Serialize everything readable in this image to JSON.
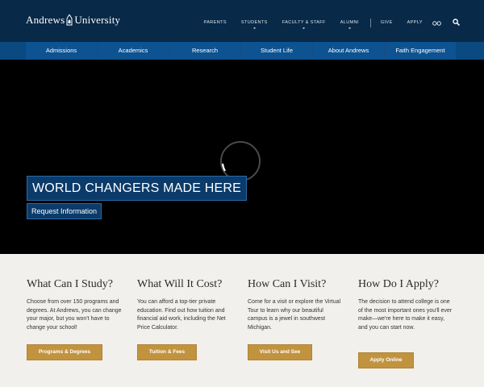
{
  "header": {
    "logo_left": "Andrews",
    "logo_right": "University",
    "links": [
      "Parents",
      "Students",
      "Faculty & Staff",
      "Alumni"
    ],
    "utility_links": [
      "Give",
      "Apply"
    ],
    "icons": [
      "glasses-icon",
      "search-icon"
    ]
  },
  "subnav": [
    "Admissions",
    "Academics",
    "Research",
    "Student Life",
    "About Andrews",
    "Faith Engagement"
  ],
  "hero": {
    "headline": "WORLD CHANGERS MADE HERE",
    "cta": "Request Information"
  },
  "columns": [
    {
      "title": "What Can I Study?",
      "text": "Choose from over 150 programs and degrees. At Andrews, you can change your major, but you won't have to change your school!",
      "button": "Programs & Degrees"
    },
    {
      "title": "What Will It Cost?",
      "text": "You can afford a top-tier private education. Find out how tuition and financial aid work, including the Net Price Calculator.",
      "button": "Tuition & Fees"
    },
    {
      "title": "How Can I Visit?",
      "text": "Come for a visit or explore the Virtual Tour to learn why our beautiful campus is a jewel in southwest Michigan.",
      "button": "Visit Us and See"
    },
    {
      "title": "How Do I Apply?",
      "text": "The decision to attend college is one of the most important ones you'll ever make—we're here to make it easy, and you can start now.",
      "button": "Apply Online"
    }
  ],
  "colors": {
    "header_bg": "#082948",
    "subnav_bg": "#0d5291",
    "hero_bg": "#000000",
    "accent_gold": "#c2933f",
    "page_bg": "#f2f0ec"
  }
}
